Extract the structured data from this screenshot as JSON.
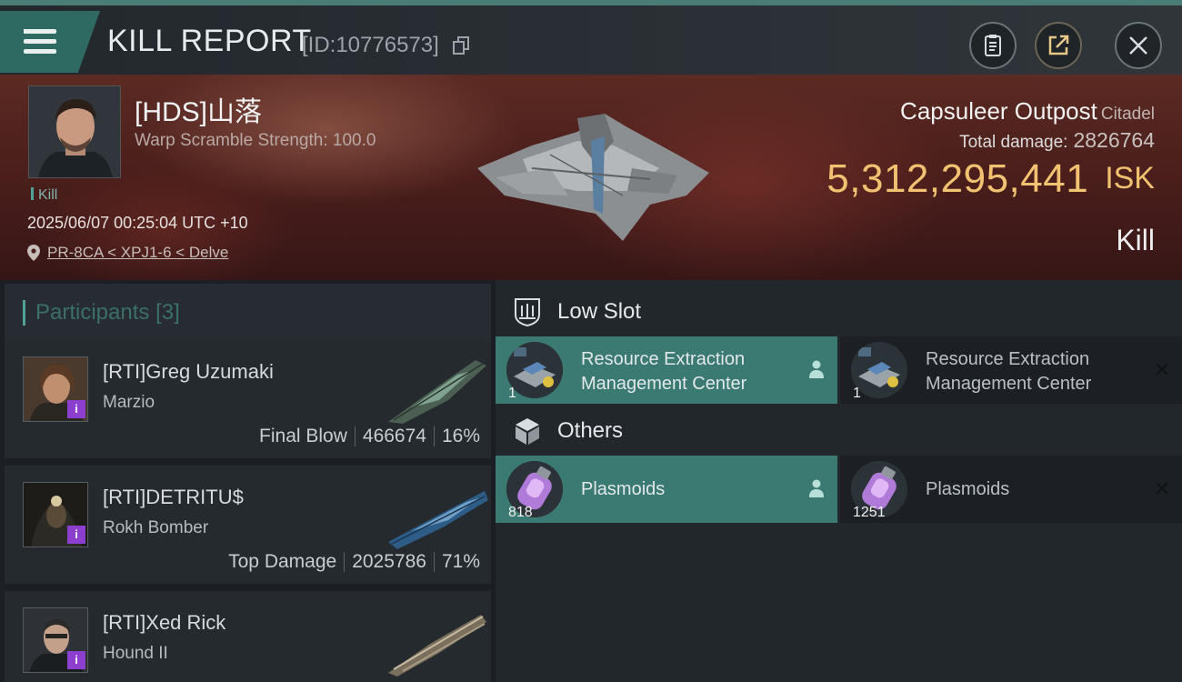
{
  "header": {
    "title": "KILL REPORT",
    "report_id": "[ID:10776573]"
  },
  "victim": {
    "name": "[HDS]山落",
    "sub": "Warp Scramble Strength: 100.0",
    "tag": "Kill",
    "time": "2025/06/07 00:25:04 UTC +10",
    "location": "PR-8CA < XPJ1-6 < Delve"
  },
  "target": {
    "name": "Capsuleer Outpost",
    "type": "Citadel",
    "damage_label": "Total damage:",
    "damage_value": "2826764",
    "isk_value": "5,312,295,441",
    "isk_unit": "ISK",
    "result": "Kill"
  },
  "participants": {
    "label": "Participants",
    "count": "[3]",
    "rows": [
      {
        "name": "[RTI]Greg Uzumaki",
        "ship": "Marzio",
        "role": "Final Blow",
        "damage": "466674",
        "percent": "16%",
        "badge": "i"
      },
      {
        "name": "[RTI]DETRITU$",
        "ship": "Rokh Bomber",
        "role": "Top Damage",
        "damage": "2025786",
        "percent": "71%",
        "badge": "i"
      },
      {
        "name": "[RTI]Xed Rick",
        "ship": "Hound II",
        "role": "",
        "damage": "",
        "percent": "",
        "badge": "i"
      }
    ]
  },
  "fitting": {
    "low_slot_label": "Low Slot",
    "others_label": "Others",
    "low_slot_items": [
      {
        "name_line1": "Resource Extraction",
        "name_line2": "Management Center",
        "qty": "1",
        "state": "dropped"
      },
      {
        "name_line1": "Resource Extraction",
        "name_line2": "Management Center",
        "qty": "1",
        "state": "destroyed"
      }
    ],
    "other_items": [
      {
        "name": "Plasmoids",
        "qty": "818",
        "state": "dropped"
      },
      {
        "name": "Plasmoids",
        "qty": "1251",
        "state": "destroyed"
      }
    ]
  },
  "colors": {
    "accent": "#3a7a72",
    "isk": "#f1c271",
    "badge": "#8c3ecf"
  }
}
